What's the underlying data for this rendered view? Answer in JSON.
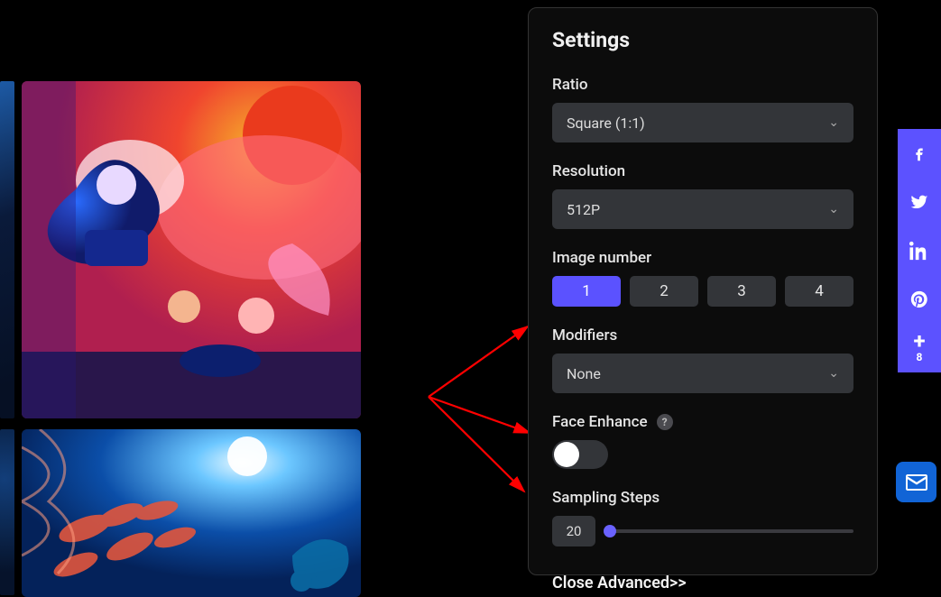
{
  "panel": {
    "title": "Settings",
    "ratio": {
      "label": "Ratio",
      "value": "Square (1:1)"
    },
    "resolution": {
      "label": "Resolution",
      "value": "512P"
    },
    "image_number": {
      "label": "Image number",
      "options": [
        "1",
        "2",
        "3",
        "4"
      ],
      "active": "1"
    },
    "modifiers": {
      "label": "Modifiers",
      "value": "None"
    },
    "face_enhance": {
      "label": "Face Enhance",
      "enabled": false
    },
    "sampling_steps": {
      "label": "Sampling Steps",
      "value": "20"
    },
    "close_advanced": "Close Advanced>>"
  },
  "social": {
    "share_count": "8"
  }
}
